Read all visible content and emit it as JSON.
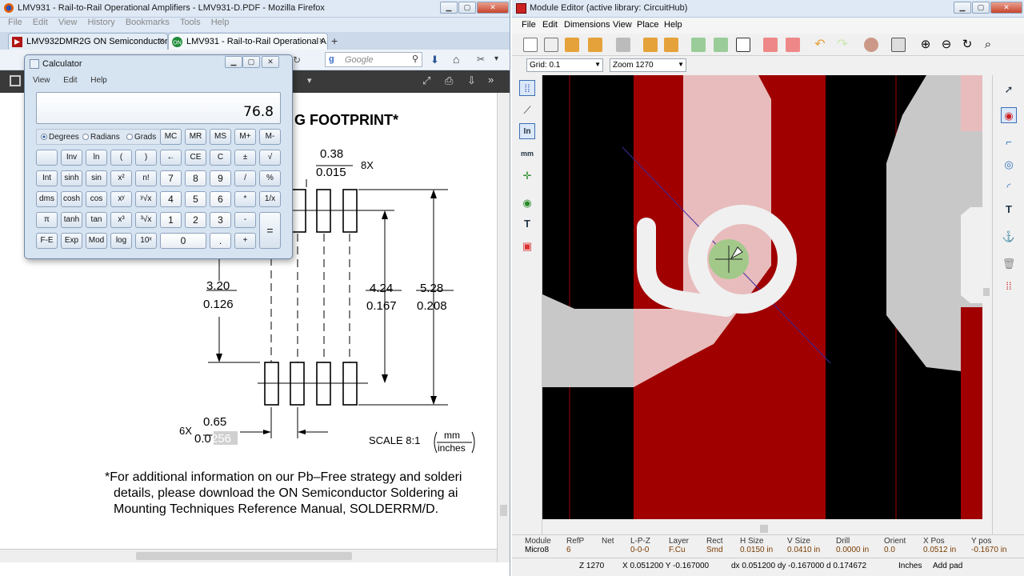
{
  "firefox": {
    "window_title": "LMV931 - Rail-to-Rail Operational Amplifiers - LMV931-D.PDF - Mozilla Firefox",
    "menu": [
      "File",
      "Edit",
      "View",
      "History",
      "Bookmarks",
      "Tools",
      "Help"
    ],
    "tabs": [
      {
        "label": "LMV932DMR2G ON Semiconductor | ..."
      },
      {
        "label": "LMV931 - Rail-to-Rail Operational A..."
      }
    ],
    "search_placeholder": "Google",
    "pdf": {
      "heading": "G FOOTPRINT*",
      "dim_038": "0.38",
      "dim_0015": "0.015",
      "mult_8x": "8X",
      "dim_320": "3.20",
      "dim_0126": "0.126",
      "dim_424": "4.24",
      "dim_0167": "0.167",
      "dim_528": "5.28",
      "dim_0208": "0.208",
      "mult_6x": "6X",
      "dim_065": "0.65",
      "dim_0256a": "0.0",
      "dim_0256b": "256",
      "scale": "SCALE 8:1",
      "unit_mm": "mm",
      "unit_inches": "inches",
      "foot1": "*For additional information on our Pb–Free strategy and solderi",
      "foot2": "details, please download the ON Semiconductor Soldering ai",
      "foot3": "Mounting Techniques Reference Manual, SOLDERRM/D."
    }
  },
  "calculator": {
    "title": "Calculator",
    "menu": [
      "View",
      "Edit",
      "Help"
    ],
    "display": "76.8",
    "modes": [
      "Degrees",
      "Radians",
      "Grads"
    ],
    "selected_mode": "Degrees",
    "memory": [
      "MC",
      "MR",
      "MS",
      "M+",
      "M-"
    ],
    "rows": [
      [
        "",
        "Inv",
        "ln",
        "(",
        ")",
        "←",
        "CE",
        "C",
        "±",
        "√"
      ],
      [
        "Int",
        "sinh",
        "sin",
        "x²",
        "n!",
        "7",
        "8",
        "9",
        "/",
        "%"
      ],
      [
        "dms",
        "cosh",
        "cos",
        "xʸ",
        "ʸ√x",
        "4",
        "5",
        "6",
        "*",
        "1/x"
      ],
      [
        "π",
        "tanh",
        "tan",
        "x³",
        "³√x",
        "1",
        "2",
        "3",
        "-",
        "="
      ],
      [
        "F-E",
        "Exp",
        "Mod",
        "log",
        "10ˣ",
        "0",
        ".",
        "+"
      ]
    ]
  },
  "module_editor": {
    "window_title": "Module Editor (active library: CircuitHub)",
    "menu": [
      "File",
      "Edit",
      "Dimensions",
      "View",
      "Place",
      "Help"
    ],
    "grid": "Grid: 0.1",
    "zoom": "Zoom 1270",
    "status": {
      "module_h": "Module",
      "module_v": "Micro8",
      "refp_h": "RefP",
      "refp_v": "6",
      "net_h": "Net",
      "net_v": "",
      "lpz_h": "L-P-Z",
      "lpz_v": "0-0-0",
      "layer_h": "Layer",
      "layer_v": "F.Cu",
      "rect_h": "Rect",
      "rect_v": "Smd",
      "hsize_h": "H Size",
      "hsize_v": "0.0150 in",
      "vsize_h": "V Size",
      "vsize_v": "0.0410 in",
      "drill_h": "Drill",
      "drill_v": "0.0000 in",
      "orient_h": "Orient",
      "orient_v": "0.0",
      "xpos_h": "X Pos",
      "xpos_v": "0.0512 in",
      "ypos_h": "Y pos",
      "ypos_v": "-0.1670 in"
    },
    "bottom": {
      "z": "Z 1270",
      "xy": "X 0.051200  Y -0.167000",
      "dxy": "dx 0.051200  dy -0.167000  d 0.174672",
      "units": "Inches",
      "mode": "Add pad"
    },
    "colors": {
      "copper": "#a00000",
      "silk": "#f0f0f0",
      "pad_pink": "#e8bcbc",
      "gray": "#c8c8c8"
    }
  }
}
